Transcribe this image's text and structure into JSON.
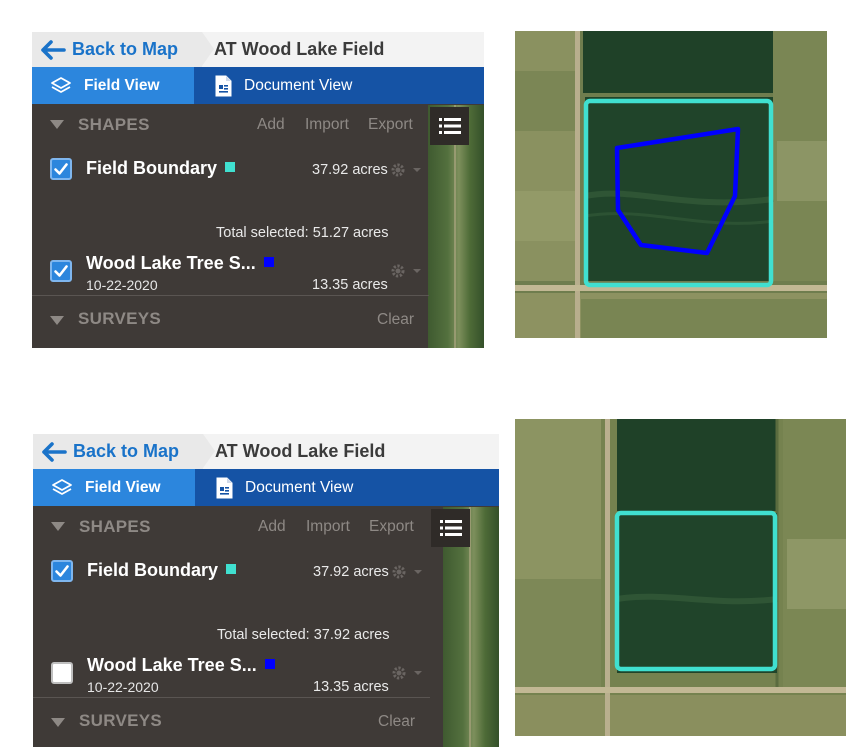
{
  "panels": [
    {
      "back_label": "Back to Map",
      "field_title": "AT Wood Lake Field",
      "tabs": {
        "field_view": "Field View",
        "document_view": "Document View"
      },
      "shapes": {
        "title": "SHAPES",
        "actions": {
          "add": "Add",
          "import": "Import",
          "export": "Export"
        },
        "items": [
          {
            "name": "Field Boundary",
            "date": "",
            "acres": "37.92 acres",
            "checked": true,
            "color": "#40e0d0"
          },
          {
            "name": "Wood Lake Tree S...",
            "date": "10-22-2020",
            "acres": "13.35 acres",
            "checked": true,
            "color": "#0000ff"
          }
        ],
        "total": "Total selected: 51.27 acres"
      },
      "surveys": {
        "title": "SURVEYS",
        "clear": "Clear"
      }
    },
    {
      "back_label": "Back to Map",
      "field_title": "AT Wood Lake Field",
      "tabs": {
        "field_view": "Field View",
        "document_view": "Document View"
      },
      "shapes": {
        "title": "SHAPES",
        "actions": {
          "add": "Add",
          "import": "Import",
          "export": "Export"
        },
        "items": [
          {
            "name": "Field Boundary",
            "date": "",
            "acres": "37.92 acres",
            "checked": true,
            "color": "#40e0d0"
          },
          {
            "name": "Wood Lake Tree S...",
            "date": "10-22-2020",
            "acres": "13.35 acres",
            "checked": false,
            "color": "#0000ff"
          }
        ],
        "total": "Total selected: 37.92 acres"
      },
      "surveys": {
        "title": "SURVEYS",
        "clear": "Clear"
      }
    }
  ],
  "maps": [
    {
      "field_boundary_color": "#40e0d0",
      "tree_survey_color": "#0000ff",
      "tree_survey_visible": true
    },
    {
      "field_boundary_color": "#40e0d0",
      "tree_survey_color": "#0000ff",
      "tree_survey_visible": false
    }
  ]
}
